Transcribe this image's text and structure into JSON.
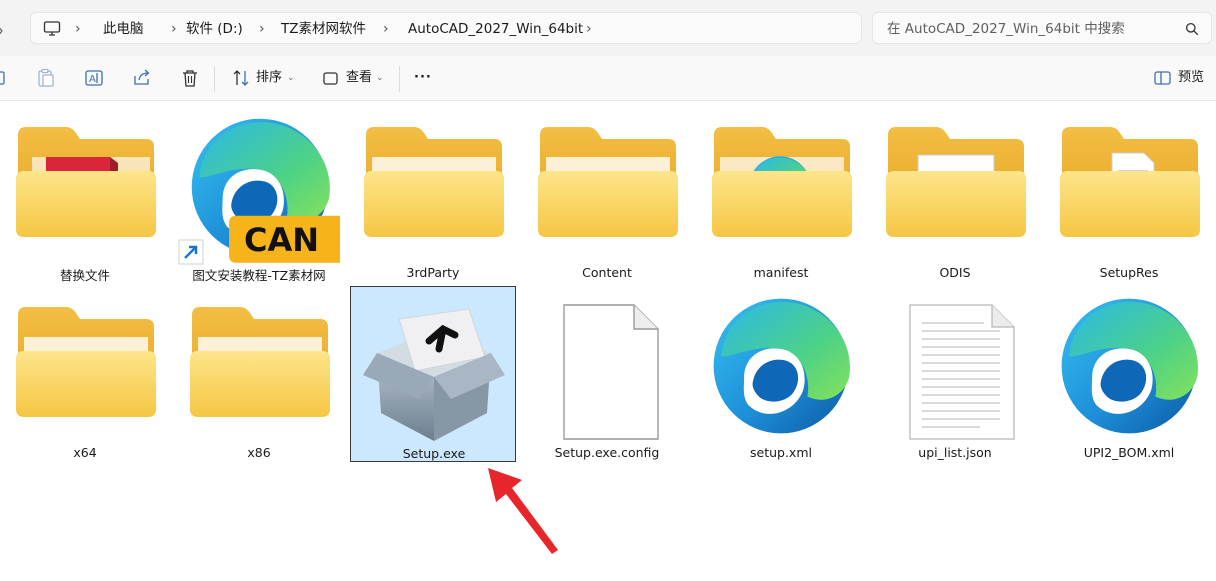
{
  "breadcrumb": {
    "items": [
      "此电脑",
      "软件 (D:)",
      "TZ素材网软件",
      "AutoCAD_2027_Win_64bit"
    ]
  },
  "search": {
    "placeholder": "在 AutoCAD_2027_Win_64bit 中搜索"
  },
  "toolbar": {
    "sort_label": "排序",
    "view_label": "查看",
    "more_label": "···",
    "preview_label": "预览"
  },
  "files": [
    {
      "name": "替换文件",
      "kind": "folder-autocad"
    },
    {
      "name": "图文安装教程-TZ素材网",
      "kind": "edge-shortcut",
      "badge": "CAN"
    },
    {
      "name": "3rdParty",
      "kind": "folder"
    },
    {
      "name": "Content",
      "kind": "folder"
    },
    {
      "name": "manifest",
      "kind": "folder-edge"
    },
    {
      "name": "ODIS",
      "kind": "folder-odis"
    },
    {
      "name": "SetupRes",
      "kind": "folder-doc"
    },
    {
      "name": "x64",
      "kind": "folder"
    },
    {
      "name": "x86",
      "kind": "folder"
    },
    {
      "name": "Setup.exe",
      "kind": "installer",
      "selected": true
    },
    {
      "name": "Setup.exe.config",
      "kind": "blank-file"
    },
    {
      "name": "setup.xml",
      "kind": "edge"
    },
    {
      "name": "upi_list.json",
      "kind": "text-file"
    },
    {
      "name": "UPI2_BOM.xml",
      "kind": "edge"
    }
  ],
  "colors": {
    "folder_front": "#f6cf4a",
    "folder_back": "#e9a928",
    "selection": "#cce8ff",
    "arrow": "#e8252b"
  }
}
